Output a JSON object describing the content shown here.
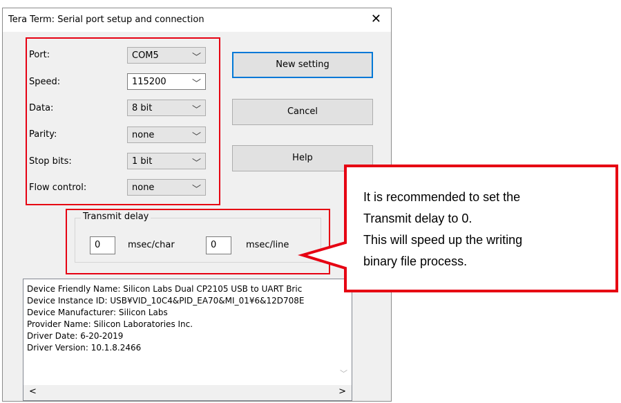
{
  "window": {
    "title": "Tera Term: Serial port setup and connection",
    "close_glyph": "✕"
  },
  "settings": [
    {
      "label": "Port:",
      "value": "COM5"
    },
    {
      "label": "Speed:",
      "value": "115200"
    },
    {
      "label": "Data:",
      "value": "8 bit"
    },
    {
      "label": "Parity:",
      "value": "none"
    },
    {
      "label": "Stop bits:",
      "value": "1 bit"
    },
    {
      "label": "Flow control:",
      "value": "none"
    }
  ],
  "buttons": {
    "new_setting": "New setting",
    "cancel": "Cancel",
    "help": "Help"
  },
  "transmit_delay": {
    "title": "Transmit delay",
    "char_value": "0",
    "char_unit": "msec/char",
    "line_value": "0",
    "line_unit": "msec/line"
  },
  "device_info": [
    "Device Friendly Name: Silicon Labs Dual CP2105 USB to UART Bric",
    "Device Instance ID: USB¥VID_10C4&PID_EA70&MI_01¥6&12D708E",
    "Device Manufacturer: Silicon Labs",
    "Provider Name: Silicon Laboratories Inc.",
    "Driver Date: 6-20-2019",
    "Driver Version: 10.1.8.2466"
  ],
  "callout": {
    "lines": [
      "It is recommended to set the",
      "Transmit delay to 0.",
      "This will speed up the writing",
      "binary file process."
    ]
  },
  "colors": {
    "highlight": "#e60012",
    "accent": "#0078d7"
  }
}
